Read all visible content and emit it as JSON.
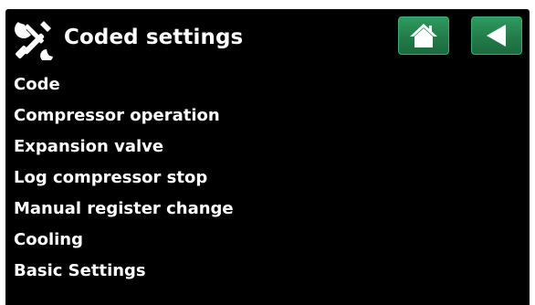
{
  "header": {
    "icon": "tools-icon",
    "title": "Coded settings"
  },
  "nav": {
    "home_icon": "home-icon",
    "back_icon": "back-arrow-icon",
    "button_color": "#237c4a"
  },
  "menu": {
    "items": [
      {
        "label": "Code"
      },
      {
        "label": "Compressor operation"
      },
      {
        "label": "Expansion valve"
      },
      {
        "label": "Log compressor stop"
      },
      {
        "label": "Manual register change"
      },
      {
        "label": "Cooling"
      },
      {
        "label": "Basic Settings"
      }
    ]
  },
  "colors": {
    "background": "#000000",
    "text": "#ffffff",
    "accent": "#237c4a"
  }
}
